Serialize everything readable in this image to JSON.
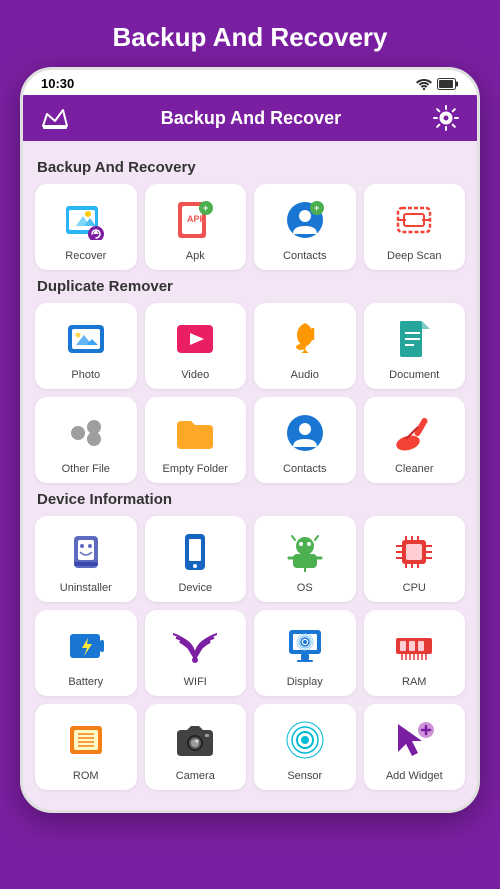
{
  "page": {
    "title": "Backup And Recovery",
    "app_bar_title": "Backup And Recover"
  },
  "status_bar": {
    "time": "10:30"
  },
  "sections": [
    {
      "label": "Backup And Recovery",
      "items": [
        {
          "name": "Recover",
          "icon": "recover"
        },
        {
          "name": "Apk",
          "icon": "apk"
        },
        {
          "name": "Contacts",
          "icon": "contacts-backup"
        },
        {
          "name": "Deep Scan",
          "icon": "deep-scan"
        }
      ]
    },
    {
      "label": "Duplicate Remover",
      "items": [
        {
          "name": "Photo",
          "icon": "photo"
        },
        {
          "name": "Video",
          "icon": "video"
        },
        {
          "name": "Audio",
          "icon": "audio"
        },
        {
          "name": "Document",
          "icon": "document"
        },
        {
          "name": "Other File",
          "icon": "other-file"
        },
        {
          "name": "Empty Folder",
          "icon": "empty-folder"
        },
        {
          "name": "Contacts",
          "icon": "contacts-dup"
        },
        {
          "name": "Cleaner",
          "icon": "cleaner"
        }
      ]
    },
    {
      "label": "Device Information",
      "items": [
        {
          "name": "Uninstaller",
          "icon": "uninstaller"
        },
        {
          "name": "Device",
          "icon": "device"
        },
        {
          "name": "OS",
          "icon": "os"
        },
        {
          "name": "CPU",
          "icon": "cpu"
        },
        {
          "name": "Battery",
          "icon": "battery"
        },
        {
          "name": "WIFI",
          "icon": "wifi"
        },
        {
          "name": "Display",
          "icon": "display"
        },
        {
          "name": "RAM",
          "icon": "ram"
        },
        {
          "name": "ROM",
          "icon": "rom"
        },
        {
          "name": "Camera",
          "icon": "camera"
        },
        {
          "name": "Sensor",
          "icon": "sensor"
        },
        {
          "name": "Add Widget",
          "icon": "add-widget"
        }
      ]
    }
  ]
}
